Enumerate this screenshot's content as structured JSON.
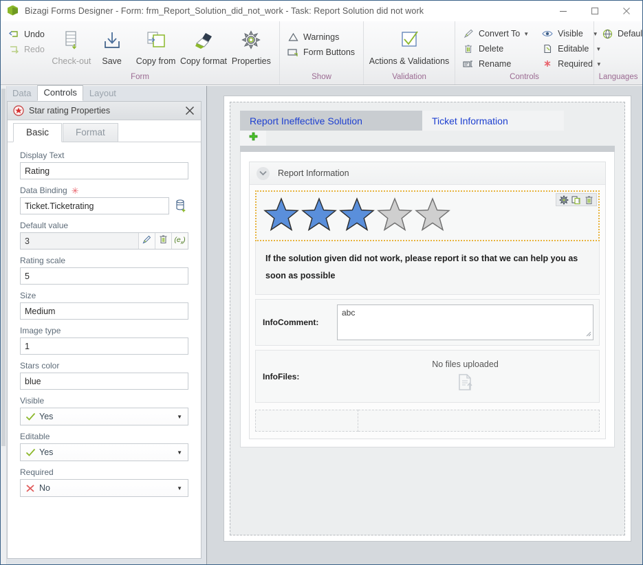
{
  "window": {
    "title": "Bizagi Forms Designer  - Form: frm_Report_Solution_did_not_work - Task:  Report Solution did not work",
    "app_icon": "bizagi-cube-icon",
    "minimize": "minimize-icon",
    "maximize": "maximize-icon",
    "close": "close-icon"
  },
  "ribbon": {
    "groups": [
      {
        "label": "Form",
        "small_commands": [
          {
            "label": "Undo",
            "icon": "undo-icon",
            "enabled": true
          },
          {
            "label": "Redo",
            "icon": "redo-icon",
            "enabled": false
          }
        ],
        "large_commands": [
          {
            "label": "Check-out",
            "icon": "check-out-icon",
            "enabled": false
          },
          {
            "label": "Save",
            "icon": "save-icon",
            "enabled": true
          },
          {
            "label": "Copy from",
            "icon": "copy-from-icon",
            "enabled": true
          },
          {
            "label": "Copy format",
            "icon": "copy-format-icon",
            "enabled": true
          },
          {
            "label": "Properties",
            "icon": "properties-gear-icon",
            "enabled": true
          }
        ]
      },
      {
        "label": "Show",
        "small_commands": [
          {
            "label": "Warnings",
            "icon": "warning-triangle-icon",
            "enabled": true
          },
          {
            "label": "Form Buttons",
            "icon": "form-buttons-icon",
            "enabled": true
          }
        ],
        "large_commands": []
      },
      {
        "label": "Validation",
        "small_commands": [],
        "large_commands": [
          {
            "label": "Actions & Validations",
            "icon": "checkbox-check-icon",
            "enabled": true
          }
        ]
      },
      {
        "label": "Controls",
        "small_commands": [
          {
            "label": "Convert To",
            "icon": "convert-to-pencil-icon",
            "enabled": true,
            "dropdown": true
          },
          {
            "label": "Delete",
            "icon": "trash-icon",
            "enabled": true
          },
          {
            "label": "Rename",
            "icon": "rename-icon",
            "enabled": true
          }
        ],
        "small_commands_2": [
          {
            "label": "Visible",
            "icon": "eye-icon",
            "enabled": true,
            "dropdown": true
          },
          {
            "label": "Editable",
            "icon": "editable-page-icon",
            "enabled": true,
            "dropdown": true
          },
          {
            "label": "Required",
            "icon": "required-asterisk-icon",
            "enabled": true,
            "dropdown": true
          }
        ],
        "large_commands": []
      },
      {
        "label": "Languages",
        "small_commands": [
          {
            "label": "Default",
            "icon": "globe-icon",
            "enabled": true,
            "dropdown": true
          }
        ],
        "large_commands": []
      }
    ]
  },
  "left_panel": {
    "tabs": [
      {
        "label": "Data",
        "active": false
      },
      {
        "label": "Controls",
        "active": true
      },
      {
        "label": "Layout",
        "active": false
      }
    ],
    "properties_panel": {
      "icon": "star-rating-icon",
      "title": "Star rating Properties",
      "close_icon": "close-icon",
      "tabs": [
        {
          "label": "Basic",
          "active": true
        },
        {
          "label": "Format",
          "active": false
        }
      ],
      "fields": [
        {
          "name": "display-text",
          "label": "Display Text",
          "value": "Rating",
          "type": "text",
          "required": false
        },
        {
          "name": "data-binding",
          "label": "Data Binding",
          "value": "Ticket.Ticketrating",
          "type": "text-with-button",
          "required": true,
          "button_icon": "database-add-icon"
        },
        {
          "name": "default-value",
          "label": "Default value",
          "value": "3",
          "type": "default-value-row",
          "buttons": [
            {
              "icon": "pencil-icon",
              "name": "edit-default-value-button"
            },
            {
              "icon": "trash-icon",
              "name": "delete-default-value-button"
            },
            {
              "icon": "expression-ex-icon",
              "name": "expression-button",
              "label": "(ex)"
            }
          ]
        },
        {
          "name": "rating-scale",
          "label": "Rating scale",
          "value": "5",
          "type": "text",
          "required": false
        },
        {
          "name": "size",
          "label": "Size",
          "value": "Medium",
          "type": "text",
          "required": false
        },
        {
          "name": "image-type",
          "label": "Image type",
          "value": "1",
          "type": "text",
          "required": false
        },
        {
          "name": "stars-color",
          "label": "Stars color",
          "value": "blue",
          "type": "text",
          "required": false
        },
        {
          "name": "visible",
          "label": "Visible",
          "value": "Yes",
          "type": "combo",
          "icon": "check-green-icon"
        },
        {
          "name": "editable",
          "label": "Editable",
          "value": "Yes",
          "type": "combo",
          "icon": "check-green-icon"
        },
        {
          "name": "required",
          "label": "Required",
          "value": "No",
          "type": "combo",
          "icon": "cross-red-icon"
        }
      ]
    }
  },
  "canvas": {
    "form_tabs": [
      {
        "label": "Report Ineffective Solution",
        "active": true
      },
      {
        "label": "Ticket Information",
        "active": false
      }
    ],
    "add_tab_icon": "plus-green-icon",
    "section": {
      "collapse_icon": "chevron-down-icon",
      "title": "Report Information",
      "rating_widget": {
        "name": "star-rating-widget",
        "filled": 3,
        "total": 5,
        "filled_color": "#5a8fdb",
        "empty_color": "#cfcfcf",
        "tools": [
          {
            "icon": "gear-icon",
            "name": "widget-settings-button"
          },
          {
            "icon": "duplicate-icon",
            "name": "widget-duplicate-button"
          },
          {
            "icon": "trash-icon",
            "name": "widget-delete-button"
          }
        ]
      },
      "help_text": "If the solution given did not work, please report it so that we can help you as soon as possible",
      "rows": [
        {
          "label": "InfoComment:",
          "type": "textarea",
          "value": "abc"
        },
        {
          "label": "InfoFiles:",
          "type": "file",
          "value": "No files uploaded",
          "icon": "file-upload-icon"
        }
      ]
    }
  },
  "colors": {
    "accent_blue": "#1d3fd0",
    "star_blue": "#5a8fdb",
    "star_gray": "#cfcfcf",
    "group_label": "#9b6a92",
    "selection_orange": "#e8b33c",
    "green": "#8cb82b"
  }
}
